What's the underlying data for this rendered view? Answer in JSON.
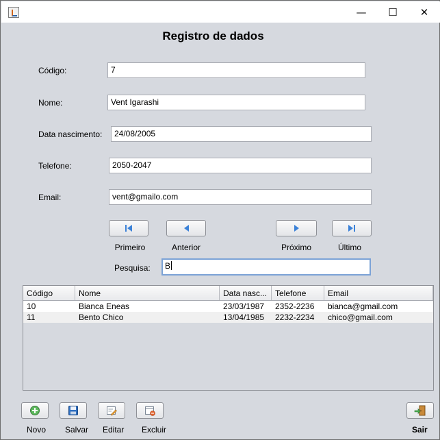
{
  "window": {
    "title": "",
    "minimize": "—",
    "maximize": "☐",
    "close": "✕"
  },
  "header": {
    "title": "Registro de dados"
  },
  "form": {
    "codigo": {
      "label": "Código:",
      "value": "7"
    },
    "nome": {
      "label": "Nome:",
      "value": "Vent Igarashi"
    },
    "data_nascimento": {
      "label": "Data nascimento:",
      "value": "24/08/2005"
    },
    "telefone": {
      "label": "Telefone:",
      "value": "2050-2047"
    },
    "email": {
      "label": "Email:",
      "value": "vent@gmailo.com"
    }
  },
  "navigation": {
    "first_label": "Primeiro",
    "previous_label": "Anterior",
    "next_label": "Próximo",
    "last_label": "Último"
  },
  "search": {
    "label": "Pesquisa:",
    "value": "B"
  },
  "table": {
    "columns": [
      "Código",
      "Nome",
      "Data nasc...",
      "Telefone",
      "Email"
    ],
    "rows": [
      [
        "10",
        "Bianca Eneas",
        "23/03/1987",
        "2352-2236",
        "bianca@gmail.com"
      ],
      [
        "11",
        "Bento Chico",
        "13/04/1985",
        "2232-2234",
        "chico@gmail.com"
      ]
    ]
  },
  "actions": {
    "novo_label": "Novo",
    "salvar_label": "Salvar",
    "editar_label": "Editar",
    "excluir_label": "Excluir",
    "sair_label": "Sair"
  },
  "colors": {
    "window_bg": "#d6d9df",
    "accent_blue": "#3c82d8",
    "focus_border": "#7ba2d6"
  },
  "icons": {
    "app": "java-cup-icon",
    "first": "skip-first-icon",
    "previous": "previous-icon",
    "next": "next-icon",
    "last": "skip-last-icon",
    "novo": "add-circle-icon",
    "salvar": "floppy-disk-icon",
    "editar": "edit-document-icon",
    "excluir": "delete-document-icon",
    "sair": "exit-door-icon"
  }
}
